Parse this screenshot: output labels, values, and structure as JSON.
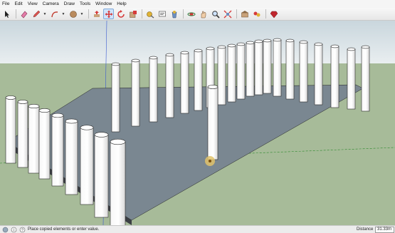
{
  "menus": [
    "File",
    "Edit",
    "View",
    "Camera",
    "Draw",
    "Tools",
    "Window",
    "Help"
  ],
  "toolbar": {
    "tools": [
      {
        "name": "select-tool-icon"
      },
      {
        "name": "eraser-tool-icon"
      },
      {
        "name": "pencil-tool-icon"
      },
      {
        "name": "arc-tool-icon"
      },
      {
        "name": "shape-tool-icon"
      },
      {
        "name": "push-pull-tool-icon"
      },
      {
        "name": "move-tool-icon"
      },
      {
        "name": "rotate-tool-icon"
      },
      {
        "name": "scale-tool-icon"
      },
      {
        "name": "tape-measure-icon"
      },
      {
        "name": "text-tool-icon"
      },
      {
        "name": "paint-bucket-icon"
      },
      {
        "name": "orbit-tool-icon"
      },
      {
        "name": "pan-tool-icon"
      },
      {
        "name": "zoom-tool-icon"
      },
      {
        "name": "zoom-extents-icon"
      },
      {
        "name": "warehouse-icon"
      },
      {
        "name": "extension-icon"
      },
      {
        "name": "ruby-icon"
      }
    ]
  },
  "viewport": {
    "sky_color": "#dfe7ec",
    "ground_color": "#a7bb99",
    "slab_color": "#6f7c86",
    "column_color": "#ffffff"
  },
  "status": {
    "message": "Place copied elements or enter value.",
    "vcb_label": "Distance",
    "vcb_value": "31.33m"
  }
}
